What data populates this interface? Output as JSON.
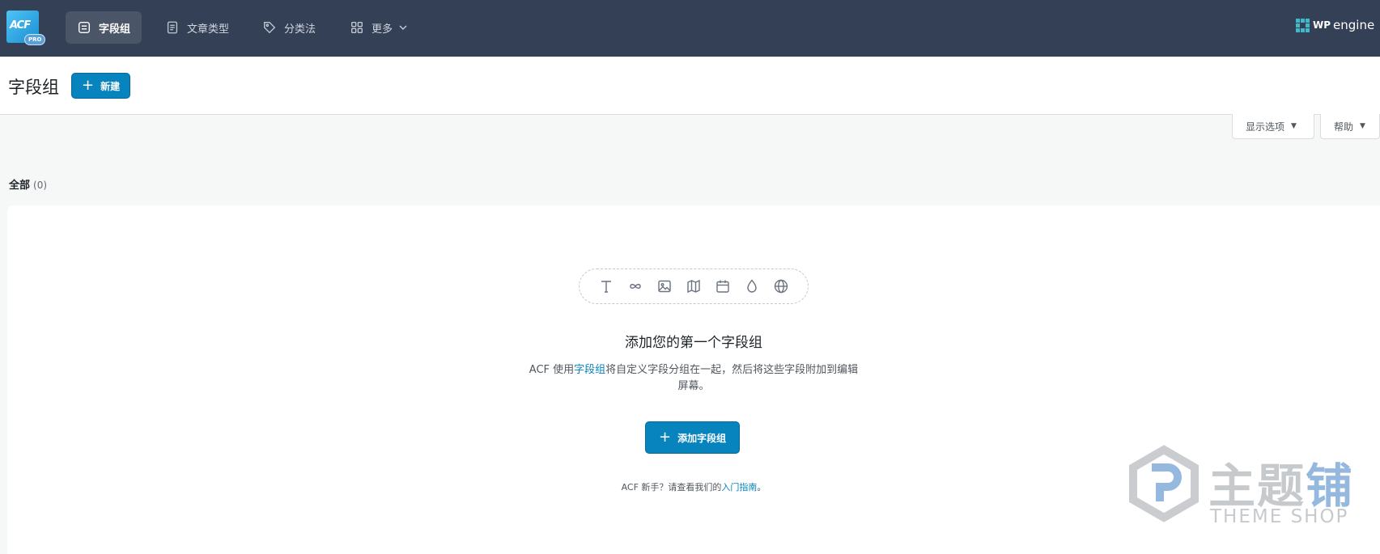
{
  "nav": {
    "logo_text": "ACF",
    "logo_badge": "PRO",
    "tabs": [
      {
        "label": "字段组",
        "icon": "field-groups-icon",
        "active": true
      },
      {
        "label": "文章类型",
        "icon": "post-types-icon",
        "active": false
      },
      {
        "label": "分类法",
        "icon": "tag-icon",
        "active": false
      },
      {
        "label": "更多",
        "icon": "grid-icon",
        "active": false
      }
    ],
    "brand": {
      "wp": "WP",
      "engine": "engine"
    }
  },
  "header": {
    "title": "字段组",
    "new_button": "新建"
  },
  "screen_meta": {
    "screen_options": "显示选项",
    "help": "帮助"
  },
  "filters": {
    "all_label": "全部",
    "all_count": "(0)"
  },
  "empty_state": {
    "icons": [
      "text-icon",
      "infinity-icon",
      "image-icon",
      "map-icon",
      "calendar-icon",
      "droplet-icon",
      "globe-icon"
    ],
    "title": "添加您的第一个字段组",
    "desc_prefix": "ACF 使用",
    "desc_link": "字段组",
    "desc_suffix": "将自定义字段分组在一起，然后将这些字段附加到编辑屏幕。",
    "add_button": "添加字段组",
    "foot_prefix": "ACF 新手？请查看我们的",
    "foot_link": "入门指南",
    "foot_suffix": "。"
  },
  "watermark": {
    "cn_a": "主题",
    "cn_b": "铺",
    "en": "THEME SHOP"
  },
  "colors": {
    "topbar": "#344055",
    "accent": "#0783be"
  }
}
